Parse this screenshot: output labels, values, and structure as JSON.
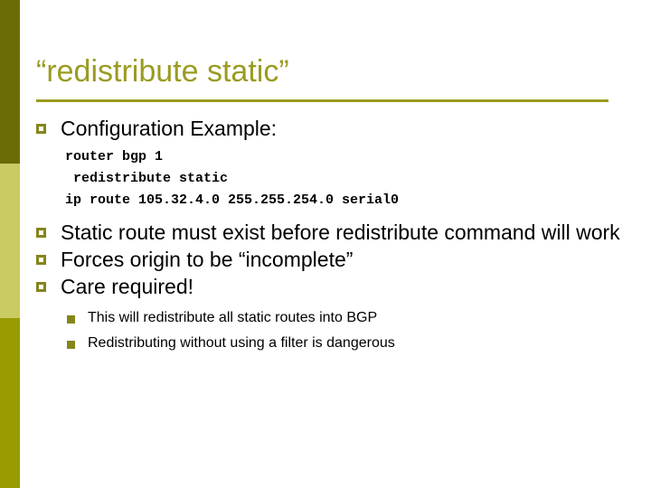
{
  "slide": {
    "title": "“redistribute static”",
    "accent_color": "#9A9B21",
    "marker_color": "#85851C",
    "sidebar": {
      "band_top_color": "#6B6B05",
      "band_middle_color": "#CACB62",
      "band_bottom_color": "#999B00"
    },
    "bullets": [
      {
        "text": "Configuration Example:"
      },
      {
        "text": "Static route must exist before redistribute command will work"
      },
      {
        "text": "Forces origin to be “incomplete”"
      },
      {
        "text": "Care required!"
      }
    ],
    "code_lines": [
      "router bgp 1",
      " redistribute static",
      "ip route 105.32.4.0 255.255.254.0 serial0"
    ],
    "sub_bullets": [
      {
        "text": "This will redistribute all static routes into BGP"
      },
      {
        "text": "Redistributing without using a filter is dangerous"
      }
    ]
  }
}
